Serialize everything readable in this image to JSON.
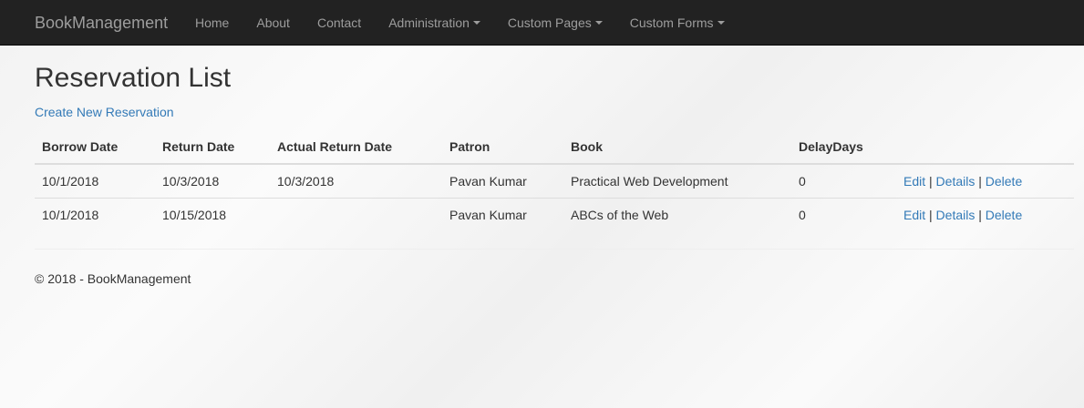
{
  "navbar": {
    "brand": "BookManagement",
    "items": [
      {
        "label": "Home",
        "dropdown": false
      },
      {
        "label": "About",
        "dropdown": false
      },
      {
        "label": "Contact",
        "dropdown": false
      },
      {
        "label": "Administration",
        "dropdown": true
      },
      {
        "label": "Custom Pages",
        "dropdown": true
      },
      {
        "label": "Custom Forms",
        "dropdown": true
      }
    ]
  },
  "page": {
    "title": "Reservation List",
    "create_link": "Create New Reservation"
  },
  "table": {
    "headers": [
      "Borrow Date",
      "Return Date",
      "Actual Return Date",
      "Patron",
      "Book",
      "DelayDays",
      ""
    ],
    "rows": [
      {
        "borrow_date": "10/1/2018",
        "return_date": "10/3/2018",
        "actual_return_date": "10/3/2018",
        "patron": "Pavan Kumar",
        "book": "Practical Web Development",
        "delay_days": "0"
      },
      {
        "borrow_date": "10/1/2018",
        "return_date": "10/15/2018",
        "actual_return_date": "",
        "patron": "Pavan Kumar",
        "book": "ABCs of the Web",
        "delay_days": "0"
      }
    ],
    "actions": {
      "edit": "Edit",
      "details": "Details",
      "delete": "Delete",
      "separator": "|"
    }
  },
  "footer": {
    "text": "© 2018 - BookManagement"
  },
  "colors": {
    "navbar_bg": "#222222",
    "navbar_text": "#9d9d9d",
    "link": "#337ab7",
    "text": "#333333",
    "table_border": "#dddddd"
  }
}
